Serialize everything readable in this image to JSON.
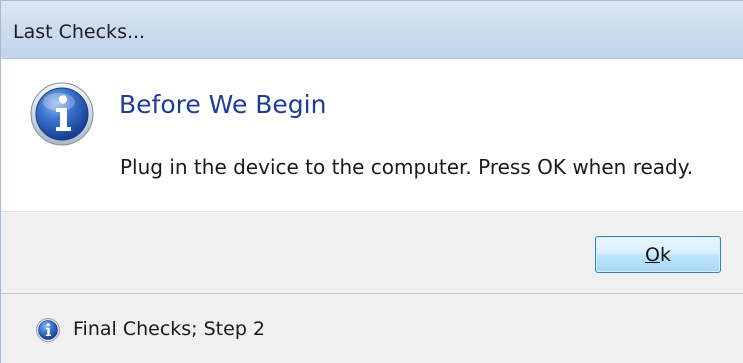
{
  "window": {
    "title": "Last Checks..."
  },
  "content": {
    "heading": "Before We Begin",
    "message": "Plug in the device to the computer. Press OK when ready.",
    "icon": "info-icon"
  },
  "buttons": {
    "ok_first_letter": "O",
    "ok_rest": "k"
  },
  "status": {
    "icon": "info-icon",
    "text": "Final Checks; Step 2"
  },
  "colors": {
    "heading": "#1f3c98",
    "titlebar": "#cbdaee",
    "footer": "#f0f0f0",
    "icon_blue": "#2b67c4"
  }
}
